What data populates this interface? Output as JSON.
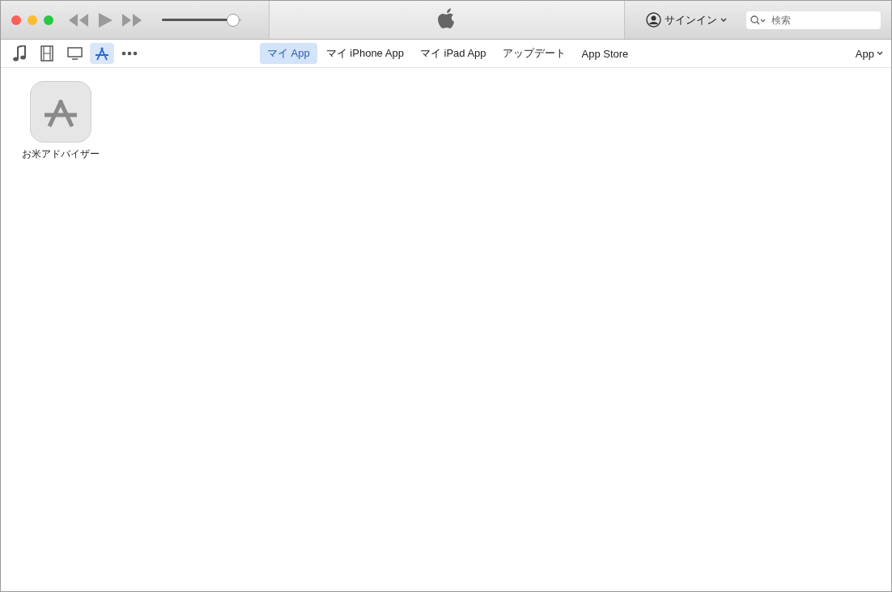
{
  "player": {
    "volume": {
      "level": 0.97
    }
  },
  "account": {
    "label": "サインイン"
  },
  "search": {
    "placeholder": "検索"
  },
  "media_kinds": [
    {
      "kind": "music",
      "selected": false
    },
    {
      "kind": "movies",
      "selected": false
    },
    {
      "kind": "tv",
      "selected": false
    },
    {
      "kind": "apps",
      "selected": true
    },
    {
      "kind": "more",
      "selected": false
    }
  ],
  "tabs": [
    {
      "label": "マイ App",
      "selected": true
    },
    {
      "label": "マイ iPhone App",
      "selected": false
    },
    {
      "label": "マイ iPad App",
      "selected": false
    },
    {
      "label": "アップデート",
      "selected": false
    },
    {
      "label": "App Store",
      "selected": false
    }
  ],
  "view_menu": {
    "label": "App"
  },
  "apps": [
    {
      "name": "お米アドバイザー"
    }
  ]
}
